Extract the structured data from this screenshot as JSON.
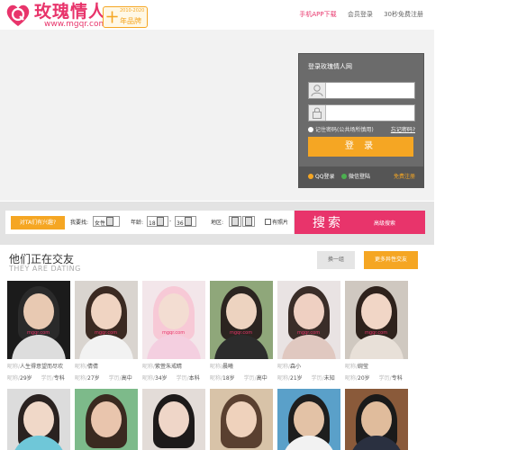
{
  "header": {
    "logo_name": "玫瑰情人",
    "logo_url": "www.mgqr.com",
    "badge_big": "十",
    "badge_years": "2010-2020",
    "badge_text": "年品牌",
    "links": [
      "手机APP下载",
      "会员登录",
      "30秒免费注册"
    ]
  },
  "login": {
    "title": "登录玫瑰情人网",
    "username_value": "",
    "password_value": "",
    "remember_label": "记住密码(公共场所慎用)",
    "forgot_label": "忘记密码?",
    "submit_label": "登 录",
    "qq_label": "QQ登录",
    "wechat_label": "微信登陆",
    "register_label": "免费注册"
  },
  "search": {
    "tag_label": "对TA们有兴趣?",
    "find_label": "我要找:",
    "find_value": "女性",
    "age_label": "年龄:",
    "age_from": "18",
    "age_sep": "-",
    "age_to": "36",
    "area_label": "地区:",
    "area_value_1": "",
    "area_value_2": "",
    "photo_label": "有照片",
    "search_label": "搜索",
    "advanced_label": "高级搜索"
  },
  "section": {
    "title": "他们正在交友",
    "subtitle": "THEY ARE DATING",
    "change_label": "换一组",
    "more_label": "更多异性交友"
  },
  "labels": {
    "nick_key": "昵称/",
    "edu_key": "学历/"
  },
  "members": [
    {
      "nick": "人生得意望而尽欢",
      "age": "29岁",
      "edu": "专科"
    },
    {
      "nick": "倩倩",
      "age": "27岁",
      "edu": "高中"
    },
    {
      "nick": "紫萱朱戒睛",
      "age": "34岁",
      "edu": "本科"
    },
    {
      "nick": "晨曦",
      "age": "18岁",
      "edu": "高中"
    },
    {
      "nick": "森小",
      "age": "21岁",
      "edu": "未知"
    },
    {
      "nick": "婉莹",
      "age": "20岁",
      "edu": "专科"
    }
  ],
  "watermark": "mgqr.com",
  "colors": {
    "brand_pink": "#e8346b",
    "accent_orange": "#f5a623"
  }
}
